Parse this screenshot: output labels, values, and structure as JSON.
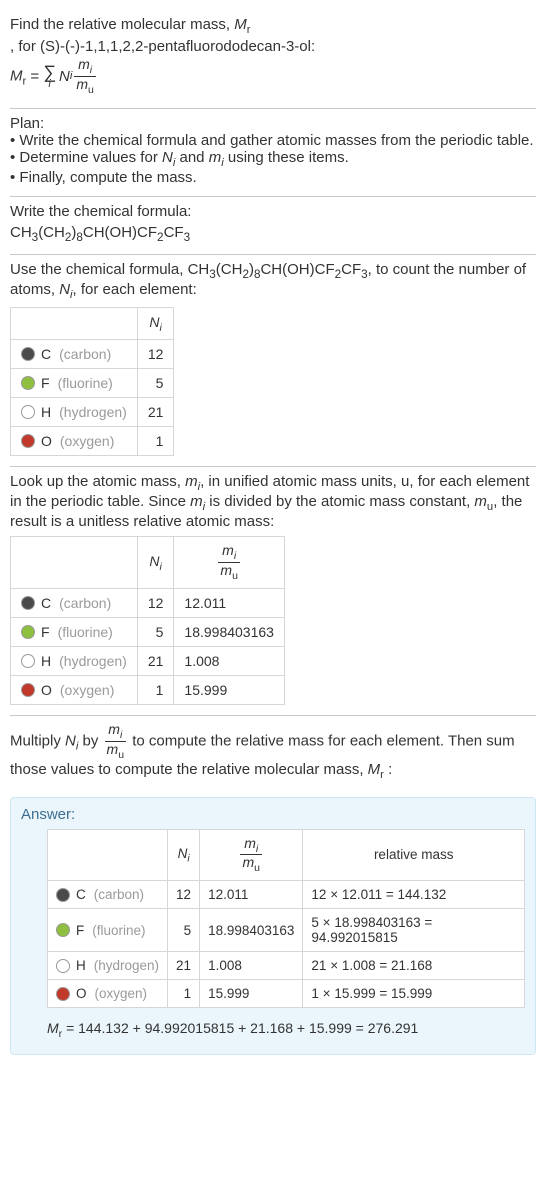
{
  "header": {
    "line1_a": "Find the relative molecular mass, ",
    "line1_sym": "M",
    "line1_sub": "r",
    "line2": ", for (S)-(-)-1,1,1,2,2-pentafluorododecan-3-ol:",
    "eq_lhs_M": "M",
    "eq_lhs_sub": "r",
    "N": "N",
    "i": "i",
    "m": "m",
    "u": "u"
  },
  "plan": {
    "title": "Plan:",
    "b1": "• Write the chemical formula and gather atomic masses from the periodic table.",
    "b2_a": "• Determine values for ",
    "b2_b": " and ",
    "b2_c": " using these items.",
    "b3": "• Finally, compute the mass."
  },
  "chem": {
    "title": "Write the chemical formula:",
    "formula_parts": [
      "CH",
      "3",
      "(CH",
      "2",
      ")",
      "8",
      "CH(OH)CF",
      "2",
      "CF",
      "3"
    ]
  },
  "count": {
    "intro_a": "Use the chemical formula, ",
    "intro_b": ", to count the number of atoms, ",
    "intro_c": ", for each element:",
    "header_Ni_N": "N",
    "header_Ni_i": "i",
    "rows": [
      {
        "sym": "C",
        "name": "(carbon)",
        "color": "#4a4a4a",
        "n": "12"
      },
      {
        "sym": "F",
        "name": "(fluorine)",
        "color": "#8fbf3f",
        "n": "5"
      },
      {
        "sym": "H",
        "name": "(hydrogen)",
        "color": "#ffffff",
        "n": "21"
      },
      {
        "sym": "O",
        "name": "(oxygen)",
        "color": "#c0392b",
        "n": "1"
      }
    ]
  },
  "lookup": {
    "intro_a": "Look up the atomic mass, ",
    "intro_b": ", in unified atomic mass units, u, for each element in the periodic table. Since ",
    "intro_c": " is divided by the atomic mass constant, ",
    "intro_d": ", the result is a unitless relative atomic mass:",
    "rows": [
      {
        "sym": "C",
        "name": "(carbon)",
        "color": "#4a4a4a",
        "n": "12",
        "m": "12.011"
      },
      {
        "sym": "F",
        "name": "(fluorine)",
        "color": "#8fbf3f",
        "n": "5",
        "m": "18.998403163"
      },
      {
        "sym": "H",
        "name": "(hydrogen)",
        "color": "#ffffff",
        "n": "21",
        "m": "1.008"
      },
      {
        "sym": "O",
        "name": "(oxygen)",
        "color": "#c0392b",
        "n": "1",
        "m": "15.999"
      }
    ]
  },
  "multiply": {
    "text_a": "Multiply ",
    "text_b": " by ",
    "text_c": " to compute the relative mass for each element. Then sum those values to compute the relative molecular mass, ",
    "text_d": " :"
  },
  "answer": {
    "label": "Answer:",
    "col_relmass": "relative mass",
    "rows": [
      {
        "sym": "C",
        "name": "(carbon)",
        "color": "#4a4a4a",
        "n": "12",
        "m": "12.011",
        "rel": "12 × 12.011 = 144.132"
      },
      {
        "sym": "F",
        "name": "(fluorine)",
        "color": "#8fbf3f",
        "n": "5",
        "m": "18.998403163",
        "rel": "5 × 18.998403163 = 94.992015815"
      },
      {
        "sym": "H",
        "name": "(hydrogen)",
        "color": "#ffffff",
        "n": "21",
        "m": "1.008",
        "rel": "21 × 1.008 = 21.168"
      },
      {
        "sym": "O",
        "name": "(oxygen)",
        "color": "#c0392b",
        "n": "1",
        "m": "15.999",
        "rel": "1 × 15.999 = 15.999"
      }
    ],
    "final": "= 144.132 + 94.992015815 + 21.168 + 15.999 = 276.291"
  }
}
